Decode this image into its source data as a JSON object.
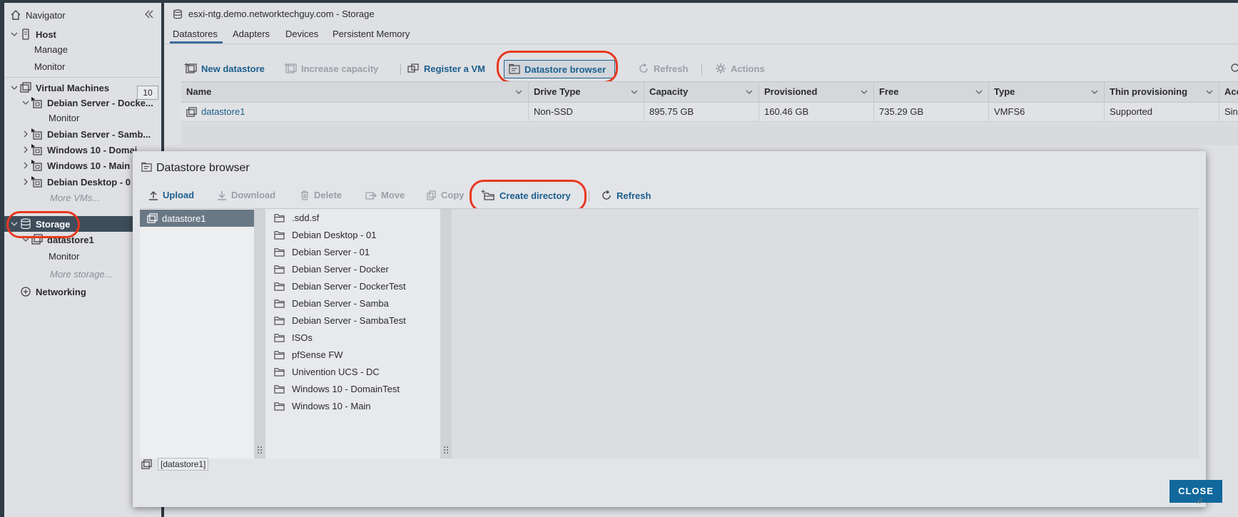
{
  "navigator": {
    "title": "Navigator",
    "host": "Host",
    "host_children": [
      "Manage",
      "Monitor"
    ],
    "virtual_machines": "Virtual Machines",
    "vm_count": "10",
    "vms": [
      "Debian Server - Docke...",
      "Monitor",
      "Debian Server - Samb...",
      "Windows 10 - Domai",
      "Windows 10 - Main",
      "Debian Desktop - 0",
      "More VMs..."
    ],
    "storage": "Storage",
    "storage_children": [
      "datastore1",
      "Monitor",
      "More storage..."
    ],
    "networking": "Networking"
  },
  "main": {
    "title": "esxi-ntg.demo.networktechguy.com - Storage",
    "tabs": [
      "Datastores",
      "Adapters",
      "Devices",
      "Persistent Memory"
    ],
    "toolbar": {
      "new_datastore": "New datastore",
      "increase_capacity": "Increase capacity",
      "register_vm": "Register a VM",
      "datastore_browser": "Datastore browser",
      "refresh": "Refresh",
      "actions": "Actions"
    },
    "columns": [
      "Name",
      "Drive Type",
      "Capacity",
      "Provisioned",
      "Free",
      "Type",
      "Thin provisioning",
      "Acc"
    ],
    "rows": [
      {
        "name": "datastore1",
        "drive_type": "Non-SSD",
        "capacity": "895.75 GB",
        "provisioned": "160.46 GB",
        "free": "735.29 GB",
        "type": "VMFS6",
        "thin": "Supported",
        "access": "Sing"
      }
    ]
  },
  "dialog": {
    "title": "Datastore browser",
    "toolbar": {
      "upload": "Upload",
      "download": "Download",
      "delete": "Delete",
      "move": "Move",
      "copy": "Copy",
      "create_directory": "Create directory",
      "refresh": "Refresh"
    },
    "datastores": [
      "datastore1"
    ],
    "files": [
      ".sdd.sf",
      "Debian Desktop - 01",
      "Debian Server - 01",
      "Debian Server - Docker",
      "Debian Server - DockerTest",
      "Debian Server - Samba",
      "Debian Server - SambaTest",
      "ISOs",
      "pfSense FW",
      "Univention UCS - DC",
      "Windows 10 - DomainTest",
      "Windows 10 - Main"
    ],
    "path": "[datastore1]",
    "close_label": "CLOSE"
  },
  "colors": {
    "accent_blue": "#1b5f8e",
    "button_blue": "#11689d",
    "highlight_red": "#e8381f",
    "nav_selected": "#3f4d5b",
    "tree_selected": "#6a7886"
  }
}
